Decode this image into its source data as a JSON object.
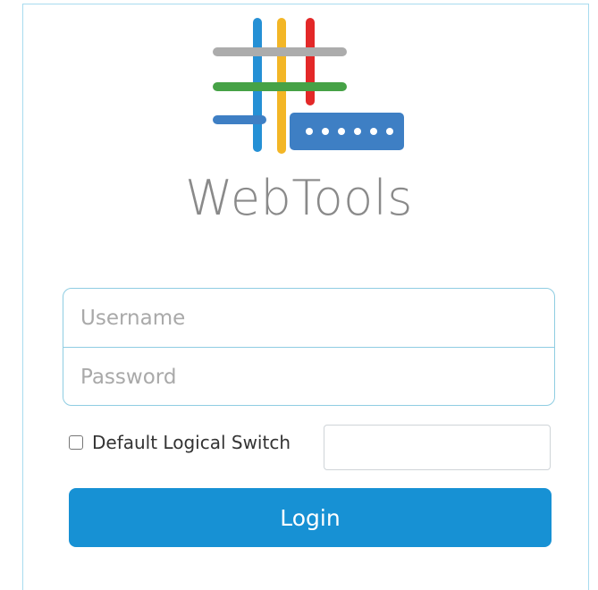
{
  "brand": {
    "name": "WebTools",
    "logo_icon": "webtools-hashtag-logo-icon",
    "colors": {
      "gray": "#acacac",
      "blue": "#2590d5",
      "yellow": "#f3b626",
      "green": "#46a246",
      "red": "#e32828",
      "panel": "#3e7fc4"
    }
  },
  "form": {
    "username_placeholder": "Username",
    "username_value": "",
    "password_placeholder": "Password",
    "password_value": "",
    "default_switch_label": "Default Logical Switch",
    "default_switch_checked": false,
    "switch_value": "",
    "login_label": "Login"
  },
  "theme": {
    "accent": "#1791d4",
    "border": "#8fcde2"
  }
}
